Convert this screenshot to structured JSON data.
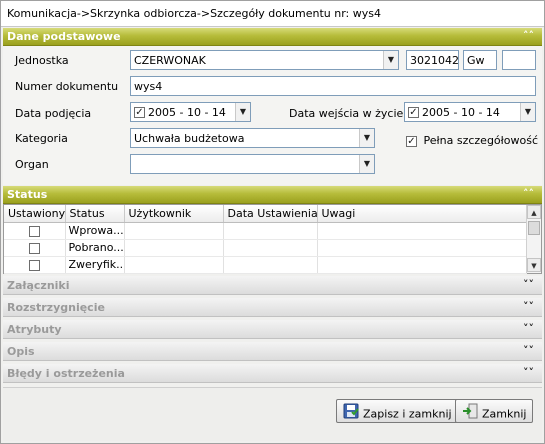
{
  "breadcrumb": "Komunikacja->Skrzynka odbiorcza->Szczegóły dokumentu nr: wys4",
  "dane": {
    "header": "Dane podstawowe",
    "jednostka": {
      "label": "Jednostka",
      "value": "CZERWONAK",
      "code": "3021042",
      "type": "Gw",
      "extra": ""
    },
    "numer": {
      "label": "Numer dokumentu",
      "value": "wys4"
    },
    "data_podjecia": {
      "label": "Data podjęcia",
      "value": "2005 - 10 - 14"
    },
    "data_wejscia": {
      "label": "Data wejścia w życie",
      "value": "2005 - 10 - 14"
    },
    "kategoria": {
      "label": "Kategoria",
      "value": "Uchwała budżetowa"
    },
    "pelna": {
      "label": "Pełna szczegółowość",
      "checked": true
    },
    "organ": {
      "label": "Organ",
      "value": ""
    }
  },
  "status": {
    "header": "Status",
    "columns": [
      "Ustawiony",
      "Status",
      "Użytkownik",
      "Data Ustawienia",
      "Uwagi"
    ],
    "rows": [
      {
        "status": "Wprowa...",
        "user": "",
        "date": "",
        "notes": "",
        "checked": false
      },
      {
        "status": "Pobrano...",
        "user": "",
        "date": "",
        "notes": "",
        "checked": false
      },
      {
        "status": "Zweryfik...",
        "user": "",
        "date": "",
        "notes": "",
        "checked": false
      }
    ]
  },
  "sections": [
    "Załączniki",
    "Rozstrzygnięcie",
    "Atrybuty",
    "Opis",
    "Błędy i ostrzeżenia"
  ],
  "footer": {
    "save_label": "Zapisz i zamknij",
    "close_label": "Zamknij"
  },
  "icons": {
    "expanded": "chevron-up-double-icon",
    "collapsed": "chevron-down-double-icon",
    "save": "save-icon",
    "close": "exit-icon"
  },
  "colors": {
    "section_accent": "#b6bc3a",
    "input_border": "#7f9db9"
  }
}
